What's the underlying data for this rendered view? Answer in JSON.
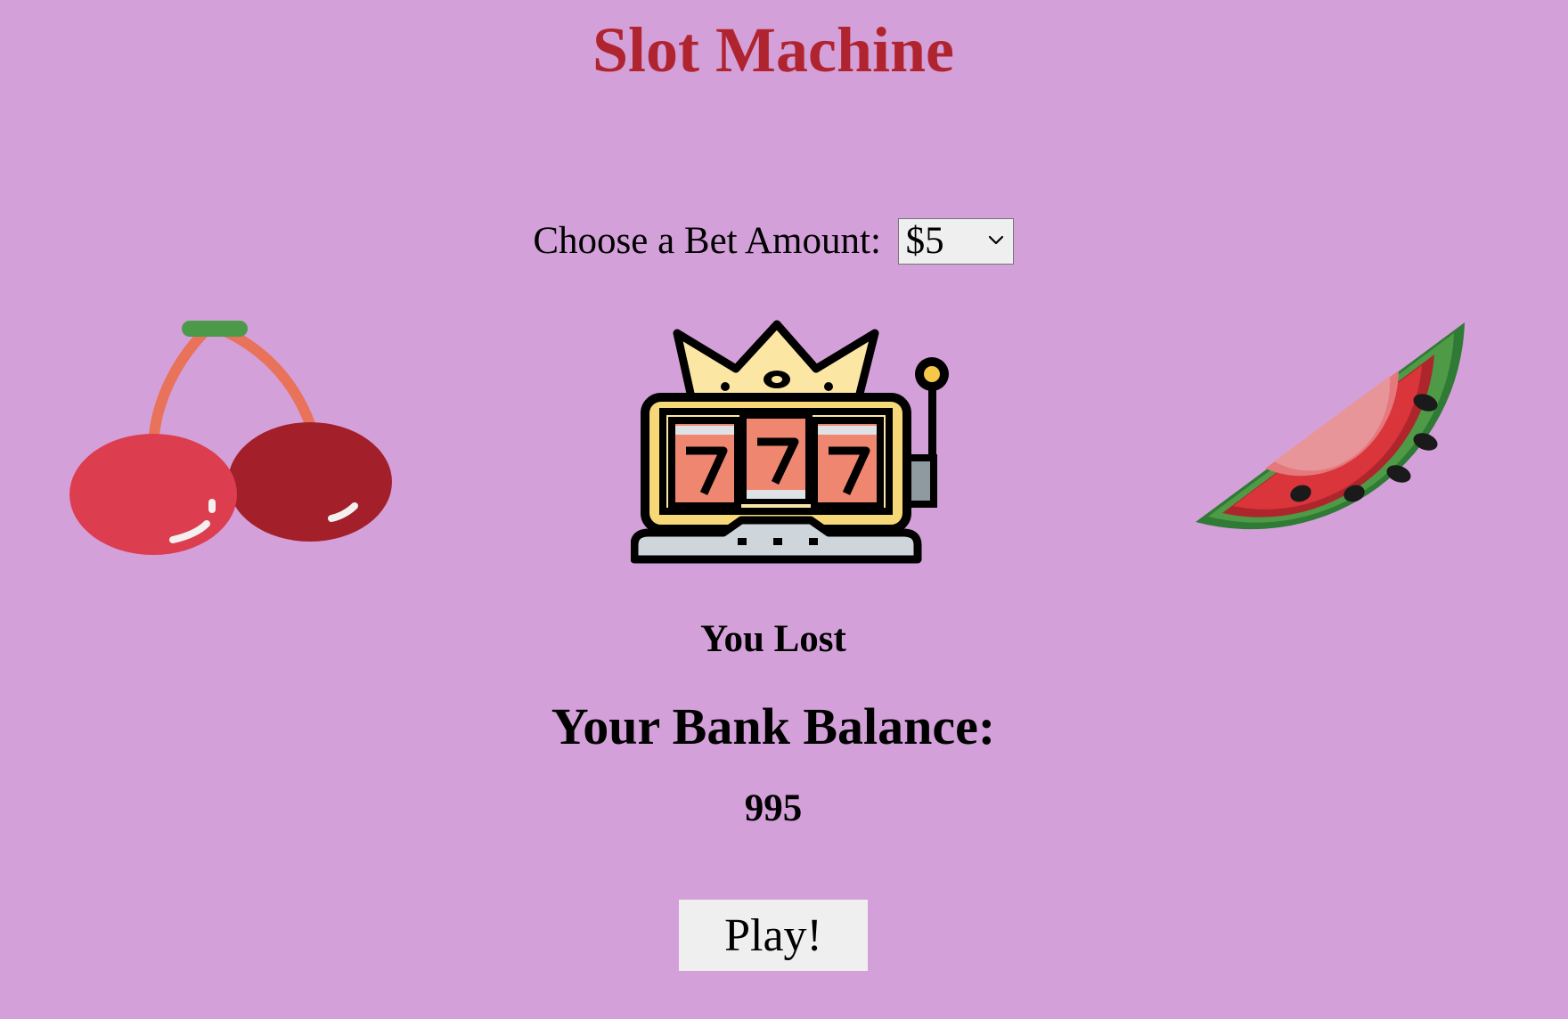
{
  "header": {
    "title": "Slot Machine"
  },
  "bet": {
    "label": "Choose a Bet Amount:",
    "selected": "$5"
  },
  "reels": [
    {
      "icon": "cherries-icon"
    },
    {
      "icon": "slot-machine-777-icon"
    },
    {
      "icon": "watermelon-icon"
    }
  ],
  "result": {
    "message": "You Lost"
  },
  "balance": {
    "heading": "Your Bank Balance:",
    "value": "995"
  },
  "actions": {
    "play_label": "Play!"
  },
  "colors": {
    "background": "#d4a0d9",
    "title": "#b0242f"
  }
}
